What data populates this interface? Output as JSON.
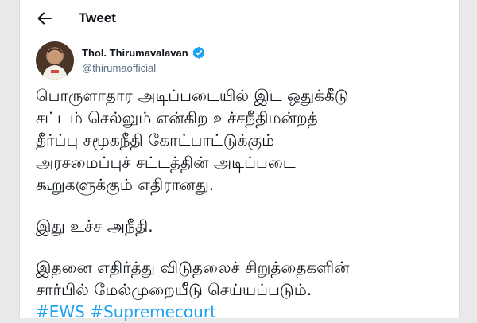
{
  "header": {
    "title": "Tweet",
    "back_icon": "back-arrow-icon"
  },
  "author": {
    "name": "Thol. Thirumavalavan",
    "handle": "@thirumaofficial",
    "verified_icon": "verified-badge-icon",
    "verified_color": "#1da1f2"
  },
  "tweet": {
    "paragraph1": [
      "பொருளாதார அடிப்படையில் இட ஒதுக்கீடு",
      "சட்டம் செல்லும் என்கிற உச்சநீதிமன்றத்",
      "தீர்ப்பு சமூகநீதி கோட்பாட்டுக்கும்",
      "அரசமைப்புச் சட்டத்தின் அடிப்படை",
      "கூறுகளுக்கும் எதிரானது."
    ],
    "paragraph2": "இது உச்ச அநீதி.",
    "paragraph3": [
      "இதனை எதிர்த்து விடுதலைச் சிறுத்தைகளின்",
      "சார்பில் மேல்முறையீடு செய்யப்படும்."
    ],
    "hashtags": [
      "#EWS",
      "#Supremecourt"
    ],
    "hashtag_color": "#1da1f2"
  }
}
